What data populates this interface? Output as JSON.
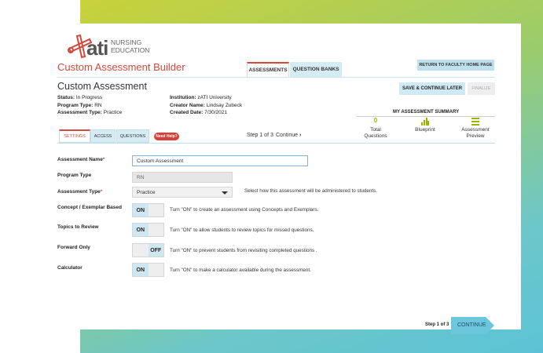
{
  "logo": {
    "brand": "ati",
    "line1": "NURSING",
    "line2": "EDUCATION"
  },
  "header": {
    "title": "Custom Assessment Builder",
    "tabs": [
      "ASSESSMENTS",
      "QUESTION BANKS"
    ],
    "return_label": "RETURN TO FACULTY HOME PAGE"
  },
  "assessment": {
    "heading": "Custom Assessment",
    "save_label": "SAVE & CONTINUE LATER",
    "finalize_label": "FINALIZE",
    "status_label": "Status:",
    "status": "In Progress",
    "program_label": "Program Type:",
    "program": "RN",
    "type_label": "Assessment Type:",
    "type": "Practice",
    "institution_label": "Institution:",
    "institution": "zATI University",
    "creator_label": "Creator Name:",
    "creator": "Lindsay Zubeck",
    "created_label": "Created Date:",
    "created": "7/30/2021"
  },
  "summary": {
    "title": "MY ASSESSMENT SUMMARY",
    "items": [
      {
        "icon_value": "0",
        "label1": "Total",
        "label2": "Questions"
      },
      {
        "icon": "blueprint-icon",
        "label1": "Blueprint",
        "label2": ""
      },
      {
        "icon": "preview-icon",
        "label1": "Assessment",
        "label2": "Preview"
      }
    ],
    "accent": "#9cb400"
  },
  "subtabs": [
    "SETTINGS",
    "ACCESS",
    "QUESTIONS"
  ],
  "help_label": "Need Help?",
  "step": {
    "text": "Step 1 of 3",
    "continue": "Continue"
  },
  "form": {
    "name_label": "Assessment Name",
    "name_value": "Custom Assessment",
    "program_label": "Program Type",
    "program_value": "RN",
    "type_label": "Assessment Type",
    "type_value": "Practice",
    "type_hint": "Select how this assessment will be administered to students.",
    "toggles": [
      {
        "label": "Concept / Exemplar Based",
        "state": "ON",
        "hint": "Turn \"ON\" to create an assessment using Concepts and Exemplars."
      },
      {
        "label": "Topics to Review",
        "state": "ON",
        "hint": "Turn \"ON\" to allow students to review topics for missed questions."
      },
      {
        "label": "Forward Only",
        "state": "OFF",
        "hint": "Turn \"ON\" to prevent students from revisiting completed questions ."
      },
      {
        "label": "Calculator",
        "state": "ON",
        "hint": "Turn \"ON\" to make a calculator available during the assessment."
      }
    ]
  },
  "footer": {
    "step": "Step 1 of 3",
    "continue": "CONTINUE"
  },
  "colors": {
    "brand_red": "#d34a3c",
    "tab_blue": "#d5ecf5",
    "accent_blue": "#5cc3d6"
  }
}
